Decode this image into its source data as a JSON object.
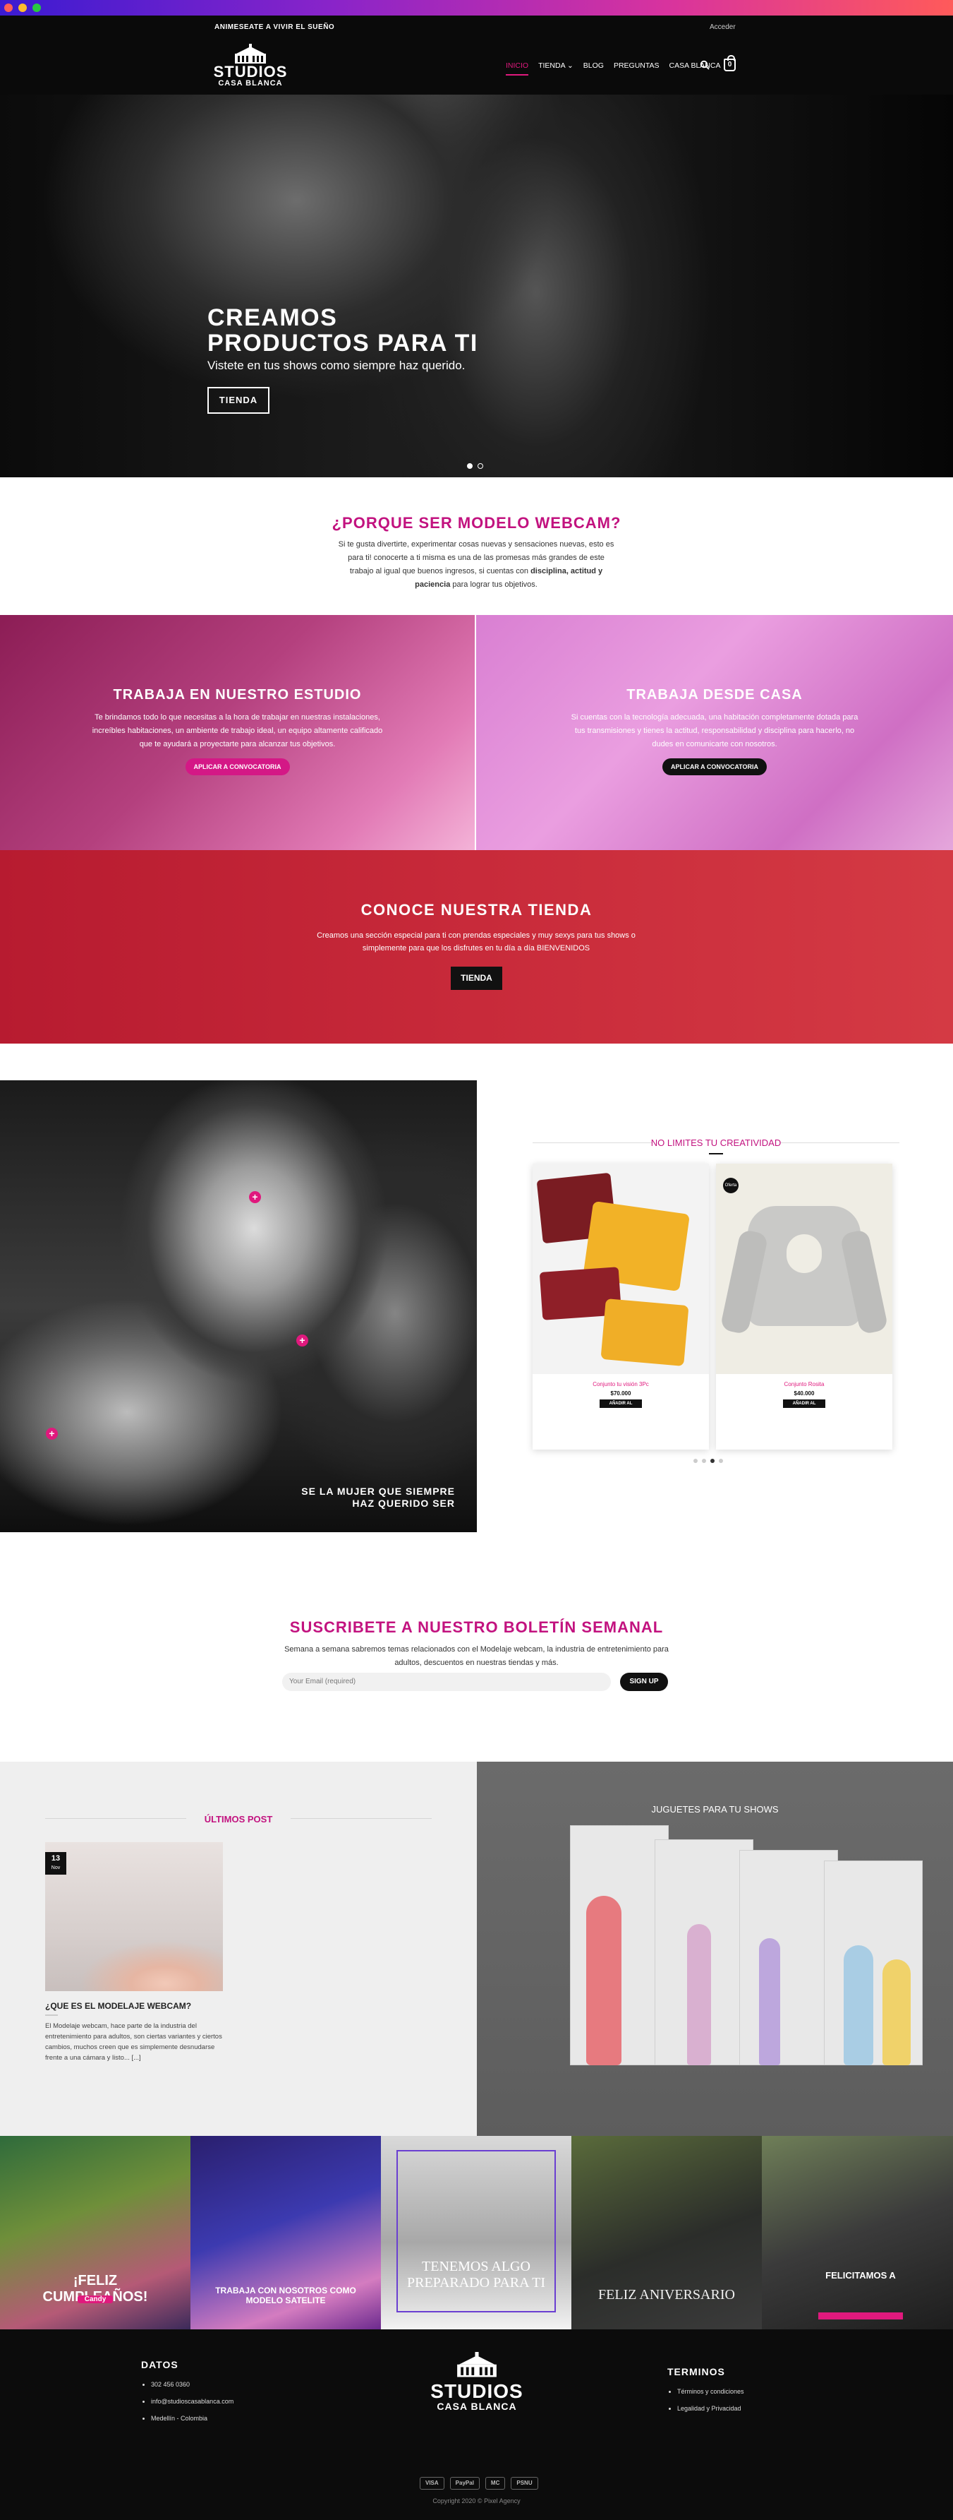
{
  "topbar": {
    "promo": "ANIMESEATE A VIVIR EL SUEÑO",
    "login": "Acceder"
  },
  "logo": {
    "line1": "STUDIOS",
    "line2": "CASA BLANCA"
  },
  "nav": {
    "items": [
      "INICIO",
      "TIENDA",
      "BLOG",
      "PREGUNTAS",
      "CASA BLANCA"
    ],
    "cart_count": "0"
  },
  "hero": {
    "title": "CREAMOS PRODUCTOS PARA TI",
    "subtitle": "Vistete en tus shows como siempre haz querido.",
    "button": "TIENDA"
  },
  "why": {
    "title": "¿PORQUE SER MODELO WEBCAM?",
    "text_start": "Si te gusta divertirte, experimentar cosas nuevas y sensaciones nuevas, esto es para ti! conocerte a ti misma es una de las promesas más grandes de este trabajo al igual que buenos ingresos, si cuentas con ",
    "text_bold": "disciplina, actitud  y paciencia",
    "text_end": " para lograr tus objetivos."
  },
  "panels": [
    {
      "title": "TRABAJA EN NUESTRO ESTUDIO",
      "text": "Te brindamos todo lo que necesitas a la hora de trabajar en nuestras instalaciones, increíbles habitaciones, un ambiente de trabajo ideal, un equipo altamente calificado que te ayudará a proyectarte para alcanzar tus objetivos.",
      "button": "APLICAR A CONVOCATORIA"
    },
    {
      "title": "TRABAJA DESDE CASA",
      "text": "Si cuentas con la tecnología adecuada, una habitación completamente dotada para tus transmisiones y tienes la actitud, responsabilidad y disciplina para hacerlo, no dudes en comunicarte con nosotros.",
      "button": "APLICAR A CONVOCATORIA"
    }
  ],
  "store": {
    "title": "CONOCE NUESTRA TIENDA",
    "text": "Creamos una sección especial para ti con prendas especiales y muy sexys para tus shows o simplemente para que los disfrutes en tu día a día BIENVENIDOS",
    "button": "TIENDA"
  },
  "feature": {
    "caption": "SE LA MUJER QUE SIEMPRE HAZ QUERIDO SER",
    "hotspot": "+",
    "products_title": "NO LIMITES TU CREATIVIDAD",
    "products": [
      {
        "name": "Conjunto tu visión 3Pc",
        "price": "$70.000",
        "button": "AÑADIR AL CARRITO",
        "badge": ""
      },
      {
        "name": "Conjunto Rosita",
        "price": "$40.000",
        "button": "AÑADIR AL CARRITO",
        "badge": "Oferta"
      }
    ]
  },
  "newsletter": {
    "title": "SUSCRIBETE A NUESTRO BOLETÍN SEMANAL",
    "text": "Semana a semana sabremos temas relacionados con el Modelaje webcam, la industria  de entretenimiento para adultos, descuentos en nuestras tiendas y más.",
    "placeholder": "Your Email (required)",
    "button": "SIGN UP"
  },
  "blog": {
    "title": "ÚLTIMOS POST",
    "day": "13",
    "month": "Nov",
    "post_title": "¿QUE ES EL MODELAJE WEBCAM?",
    "excerpt": "El Modelaje webcam, hace parte de la industria del entretenimiento para adultos, son ciertas variantes y ciertos cambios, muchos creen que es simplemente desnudarse frente a una cámara y listo... [...]"
  },
  "toys": {
    "title": "JUGUETES PARA TU SHOWS"
  },
  "instagram": [
    {
      "caption": "¡FELIZ CUMPLEAÑOS!",
      "name": "Candy"
    },
    {
      "caption": "TRABAJA CON NOSOTROS COMO MODELO SATELITE"
    },
    {
      "caption": "TENEMOS ALGO PREPARADO PARA TI"
    },
    {
      "caption": "FELIZ ANIVERSARIO"
    },
    {
      "caption": "FELICITAMOS A"
    }
  ],
  "footer": {
    "data_title": "DATOS",
    "data_items": [
      "302 456 0360",
      "info@studioscasablanca.com",
      "Medellín - Colombia"
    ],
    "terms_title": "TERMINOS",
    "terms_items": [
      "Términos y condiciones",
      "Legalidad y Privacidad"
    ],
    "payments": [
      "VISA",
      "PayPal",
      "MC",
      "PSNU"
    ],
    "copyright": "Copyright 2020 © Pixel Agency"
  },
  "colors": {
    "accent": "#c2127f",
    "store_red": "#c62a3b",
    "dark": "#0a0a0a"
  }
}
